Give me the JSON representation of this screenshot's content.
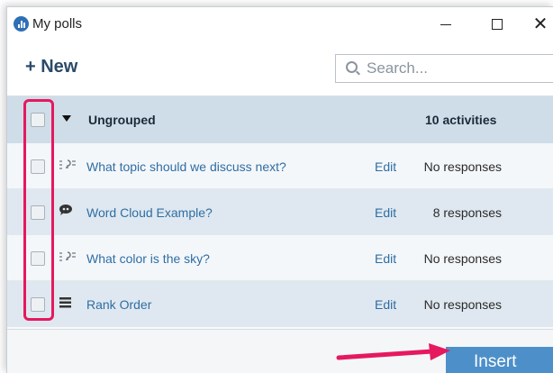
{
  "window": {
    "title": "My polls",
    "controls": {
      "minimize": "—",
      "maximize": "☐",
      "close": "✕"
    }
  },
  "toolbar": {
    "new_label": "+ New",
    "search_placeholder": "Search..."
  },
  "group": {
    "label": "Ungrouped",
    "count": "10 activities"
  },
  "rows": [
    {
      "icon": "open-ended-icon",
      "title": "What topic should we discuss next?",
      "edit": "Edit",
      "responses": "No responses"
    },
    {
      "icon": "word-cloud-icon",
      "title": "Word Cloud Example?",
      "edit": "Edit",
      "responses": "8 responses"
    },
    {
      "icon": "open-ended-icon",
      "title": "What color is the sky?",
      "edit": "Edit",
      "responses": "No responses"
    },
    {
      "icon": "rank-order-icon",
      "title": "Rank Order",
      "edit": "Edit",
      "responses": "No responses"
    }
  ],
  "footer": {
    "insert_label": "Insert"
  },
  "colors": {
    "accent": "#4d8fc9",
    "highlight": "#e6185e",
    "link": "#2f6ea3"
  }
}
